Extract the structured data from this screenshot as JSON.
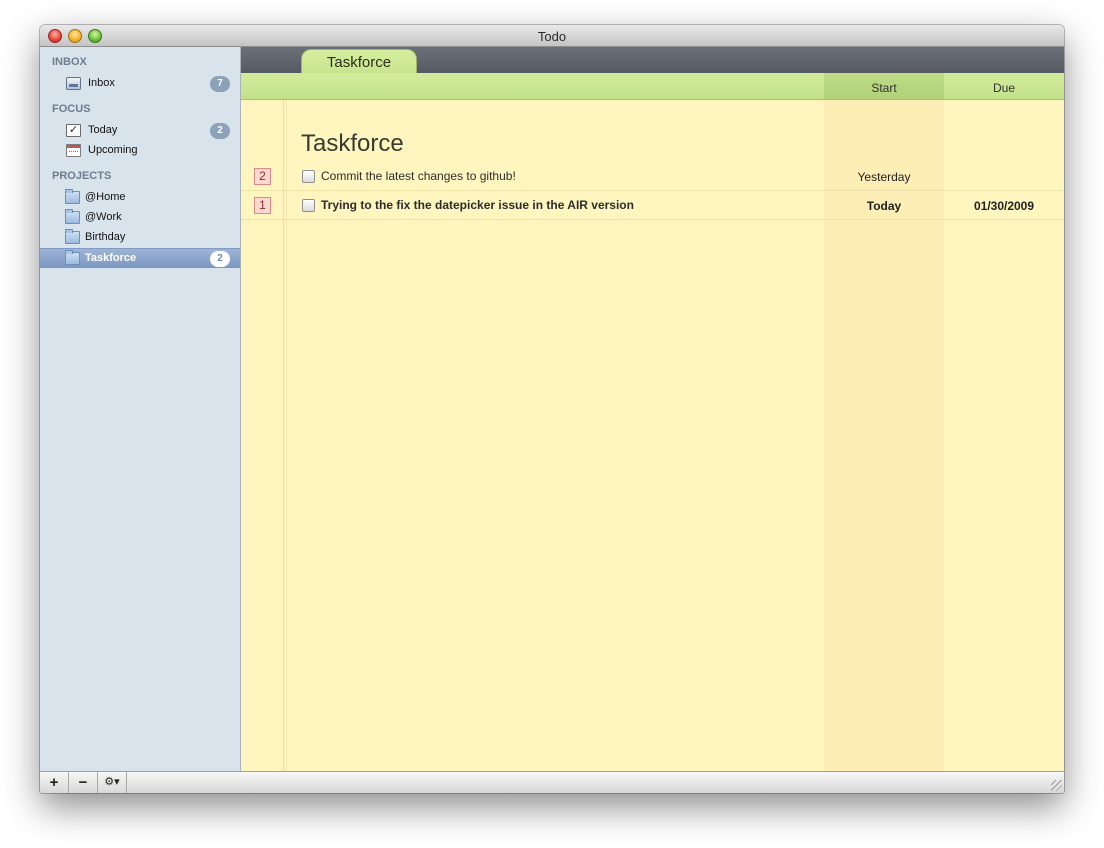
{
  "window": {
    "title": "Todo"
  },
  "sidebar": {
    "sections": {
      "inbox": "INBOX",
      "focus": "FOCUS",
      "projects": "PROJECTS"
    },
    "inbox": {
      "label": "Inbox",
      "count": "7"
    },
    "today": {
      "label": "Today",
      "count": "2"
    },
    "upcoming": {
      "label": "Upcoming"
    },
    "projects": [
      {
        "label": "@Home"
      },
      {
        "label": "@Work"
      },
      {
        "label": "Birthday"
      },
      {
        "label": "Taskforce",
        "count": "2",
        "selected": true
      }
    ]
  },
  "tab": {
    "label": "Taskforce"
  },
  "columns": {
    "start": "Start",
    "due": "Due"
  },
  "project_title": "Taskforce",
  "tasks": [
    {
      "priority": "2",
      "title": "Commit the latest changes to github!",
      "start": "Yesterday",
      "due": "",
      "bold": false
    },
    {
      "priority": "1",
      "title": "Trying to the fix the datepicker issue in the AIR version",
      "start": "Today",
      "due": "01/30/2009",
      "bold": true
    }
  ],
  "bottombar": {
    "add": "+",
    "remove": "−",
    "gear": "⚙▾"
  },
  "colors": {
    "sidebar_bg": "#d9e3ec",
    "accent_green": "#c7e38c",
    "content_bg": "#fef5bf",
    "selection": "#7a96c2"
  }
}
